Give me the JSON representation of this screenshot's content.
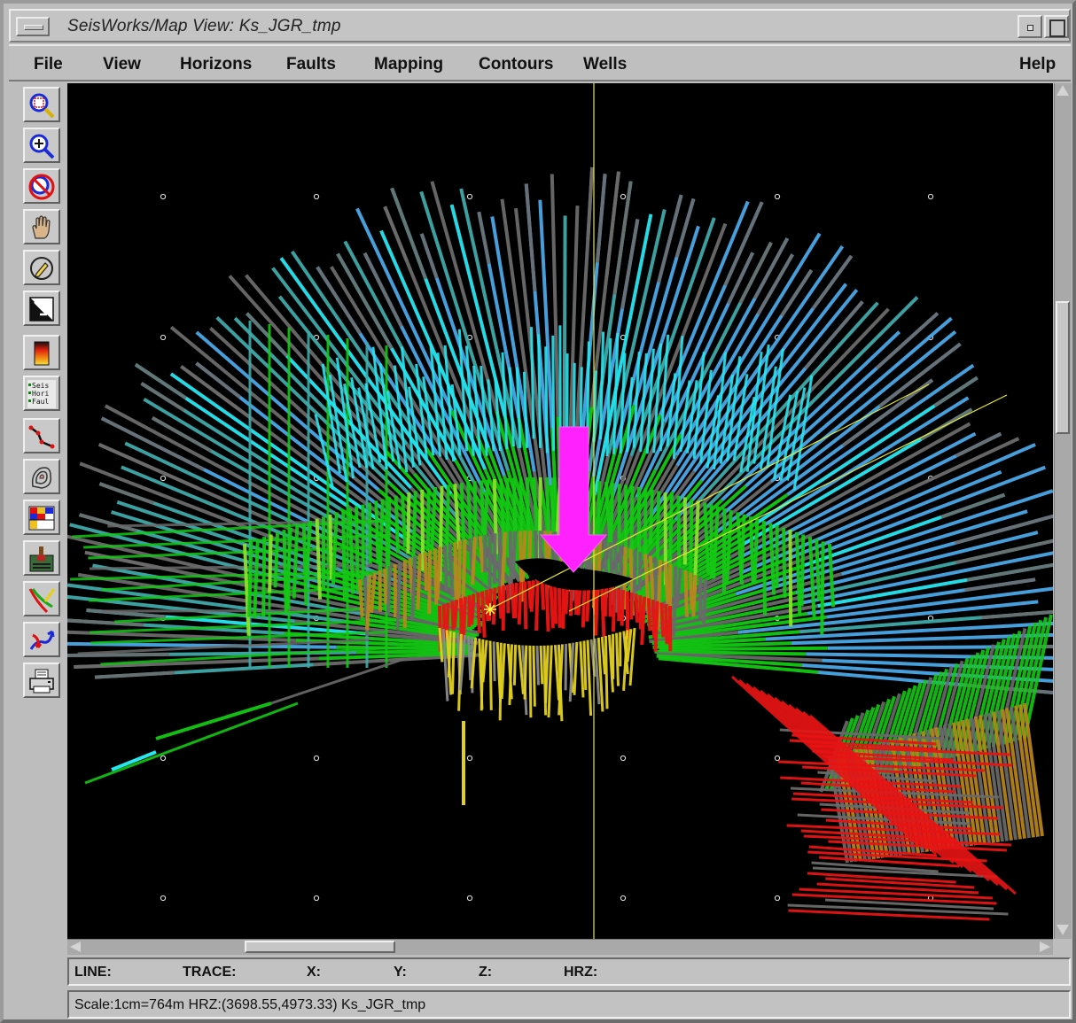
{
  "window": {
    "title": "SeisWorks/Map View: Ks_JGR_tmp"
  },
  "menu": {
    "file": "File",
    "view": "View",
    "horizons": "Horizons",
    "faults": "Faults",
    "mapping": "Mapping",
    "contours": "Contours",
    "wells": "Wells",
    "help": "Help"
  },
  "toolbar": {
    "layers_labels": [
      "Seis",
      "Hori",
      "Faul"
    ]
  },
  "status": {
    "line": "LINE:",
    "trace": "TRACE:",
    "x": "X:",
    "y": "Y:",
    "z": "Z:",
    "hrz": "HRZ:",
    "scale_text": "Scale:1cm=764m HRZ:(3698.55,4973.33) Ks_JGR_tmp"
  },
  "colors": {
    "background": "#000000",
    "arrow": "#ff22ff",
    "cursor_line": "#e8e830",
    "cyan": "#27e6f0",
    "teal": "#3fa9a9",
    "blue": "#4aa8e6",
    "green": "#14c814",
    "orange": "#b8861c",
    "red": "#e81414",
    "yellow": "#e0d020",
    "gray": "#6a6a6a"
  }
}
